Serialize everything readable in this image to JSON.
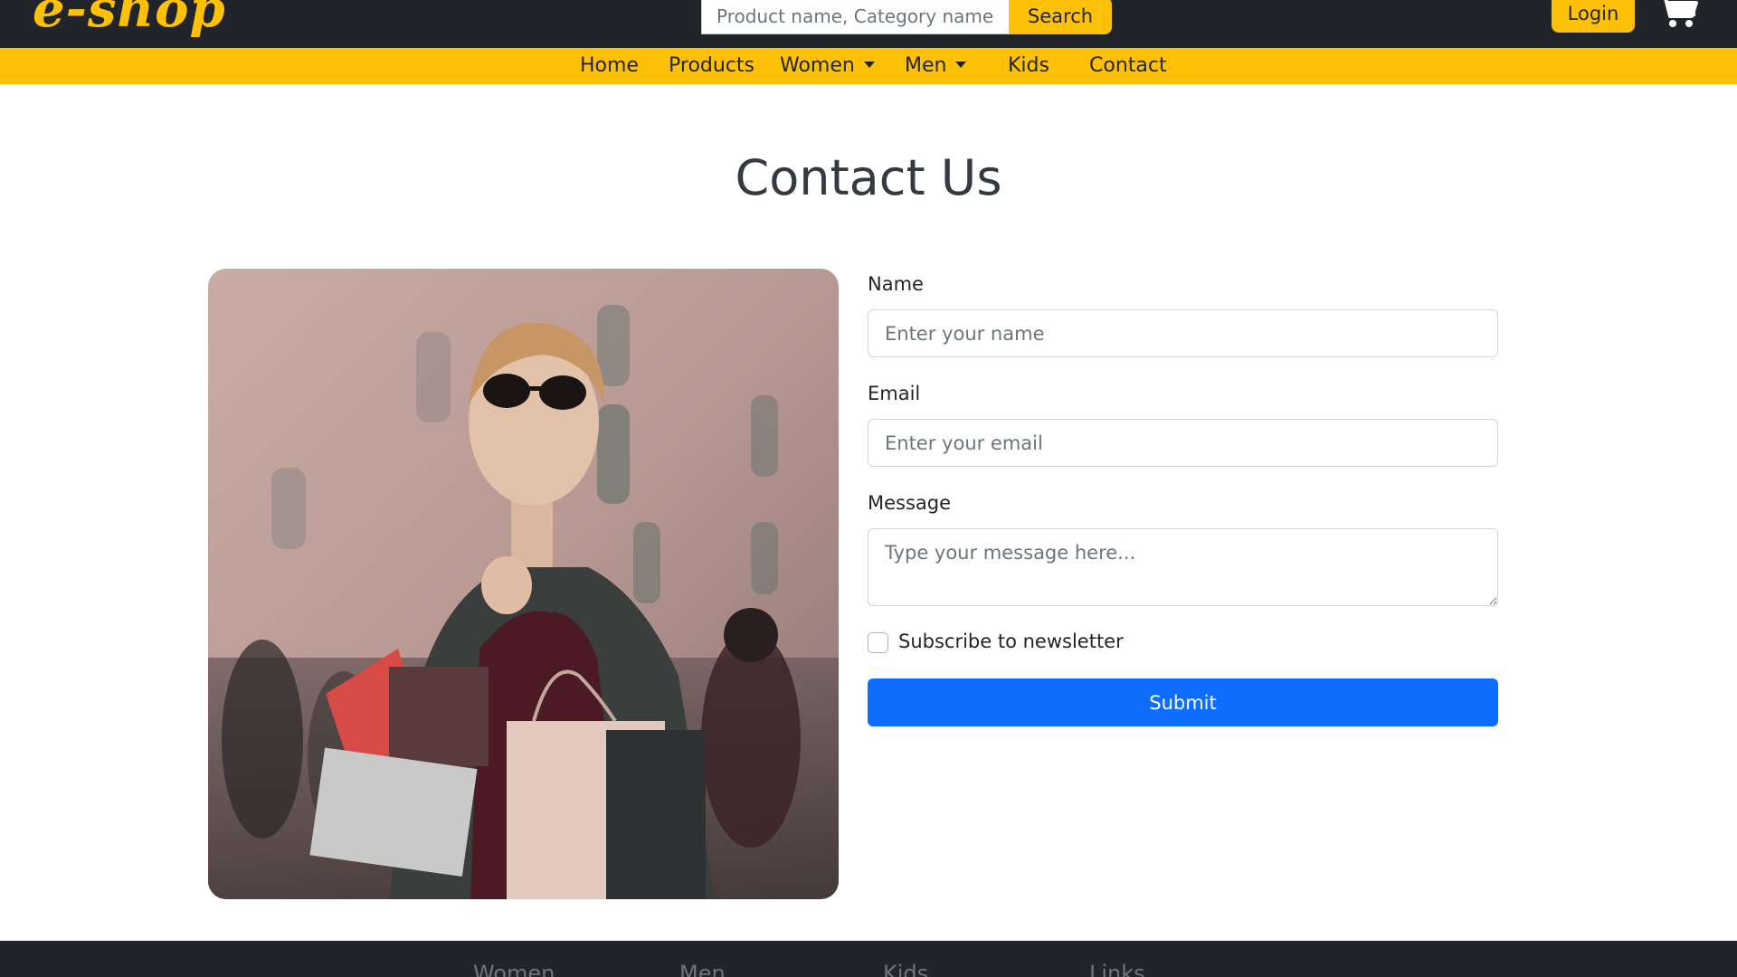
{
  "brand": {
    "logo_text": "e-shop"
  },
  "search": {
    "placeholder": "Product name, Category name",
    "button_label": "Search"
  },
  "header": {
    "login_label": "Login",
    "cart_icon": "cart-icon"
  },
  "nav": {
    "items": [
      {
        "label": "Home"
      },
      {
        "label": "Products"
      },
      {
        "label": "Women",
        "dropdown": true
      },
      {
        "label": "Men",
        "dropdown": true
      },
      {
        "label": "Kids"
      },
      {
        "label": "Contact"
      }
    ]
  },
  "main": {
    "title": "Contact Us",
    "form": {
      "name_label": "Name",
      "name_placeholder": "Enter your name",
      "email_label": "Email",
      "email_placeholder": "Enter your email",
      "message_label": "Message",
      "message_placeholder": "Type your message here...",
      "newsletter_label": "Subscribe to newsletter",
      "newsletter_checked": false,
      "submit_label": "Submit"
    }
  },
  "footer": {
    "columns": [
      {
        "heading": "Women"
      },
      {
        "heading": "Men"
      },
      {
        "heading": "Kids"
      },
      {
        "heading": "Links"
      }
    ]
  },
  "colors": {
    "accent": "#ffc107",
    "dark": "#212529",
    "primary": "#0d6efd"
  }
}
